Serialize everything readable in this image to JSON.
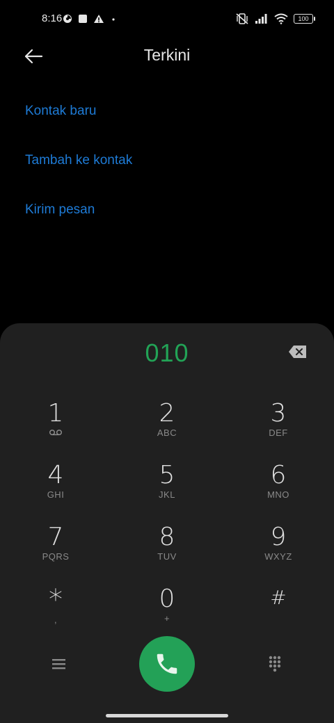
{
  "status_bar": {
    "time": "8:16",
    "battery": "100"
  },
  "top_bar": {
    "title": "Terkini"
  },
  "actions": {
    "new_contact": "Kontak baru",
    "add_to_contact": "Tambah ke kontak",
    "send_message": "Kirim pesan"
  },
  "dialpad": {
    "number": "010",
    "keys": [
      {
        "digit": "1",
        "letters": ""
      },
      {
        "digit": "2",
        "letters": "ABC"
      },
      {
        "digit": "3",
        "letters": "DEF"
      },
      {
        "digit": "4",
        "letters": "GHI"
      },
      {
        "digit": "5",
        "letters": "JKL"
      },
      {
        "digit": "6",
        "letters": "MNO"
      },
      {
        "digit": "7",
        "letters": "PQRS"
      },
      {
        "digit": "8",
        "letters": "TUV"
      },
      {
        "digit": "9",
        "letters": "WXYZ"
      },
      {
        "digit": "*",
        "letters": ","
      },
      {
        "digit": "0",
        "letters": "+"
      },
      {
        "digit": "#",
        "letters": ""
      }
    ]
  },
  "colors": {
    "accent_blue": "#1e7bd6",
    "number_green": "#22a356",
    "call_green": "#23a157",
    "sheet_bg": "#202020"
  },
  "icons": {
    "back": "arrow-left-icon",
    "backspace": "backspace-icon",
    "voicemail": "voicemail-icon",
    "menu": "menu-icon",
    "call": "phone-icon",
    "keypad": "dialpad-icon"
  }
}
